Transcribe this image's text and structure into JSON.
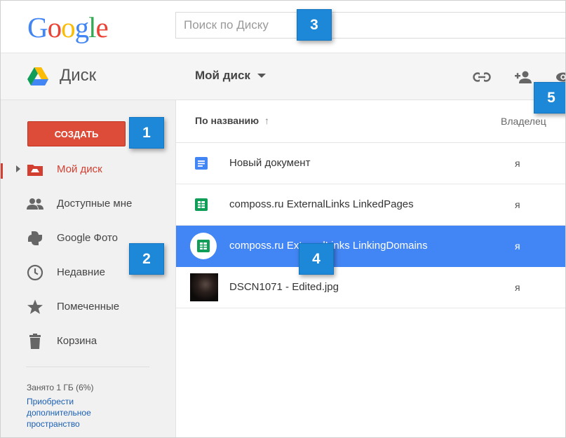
{
  "google_logo": {
    "letters": [
      {
        "ch": "G",
        "color": "#4285f4"
      },
      {
        "ch": "o",
        "color": "#ea4335"
      },
      {
        "ch": "o",
        "color": "#fbbc05"
      },
      {
        "ch": "g",
        "color": "#4285f4"
      },
      {
        "ch": "l",
        "color": "#34a853"
      },
      {
        "ch": "e",
        "color": "#ea4335"
      }
    ]
  },
  "search": {
    "placeholder": "Поиск по Диску"
  },
  "header": {
    "app_title": "Диск",
    "location_menu": "Мой диск",
    "icons": [
      "link-icon",
      "add-person-icon",
      "preview-icon"
    ]
  },
  "sidebar": {
    "create_label": "СОЗДАТЬ",
    "items": [
      {
        "label": "Мой диск",
        "icon": "my-drive-icon",
        "active": true
      },
      {
        "label": "Доступные мне",
        "icon": "shared-people-icon"
      },
      {
        "label": "Google Фото",
        "icon": "photos-pinwheel-icon"
      },
      {
        "label": "Недавние",
        "icon": "clock-icon"
      },
      {
        "label": "Помеченные",
        "icon": "star-icon"
      },
      {
        "label": "Корзина",
        "icon": "trash-icon"
      }
    ],
    "storage_text": "Занято 1 ГБ (6%)",
    "buy_link": "Приобрести дополнительное пространство"
  },
  "file_list": {
    "name_header": "По названию",
    "sort_arrow": "↑",
    "owner_header": "Владелец",
    "rows": [
      {
        "name": "Новый документ",
        "owner": "я",
        "type": "google-doc"
      },
      {
        "name": "composs.ru ExternalLinks LinkedPages",
        "owner": "я",
        "type": "google-sheet"
      },
      {
        "name": "composs.ru ExternalLinks LinkingDomains",
        "owner": "я",
        "type": "google-sheet",
        "selected": true
      },
      {
        "name": "DSCN1071 - Edited.jpg",
        "owner": "я",
        "type": "image"
      }
    ]
  },
  "callouts": [
    "1",
    "2",
    "3",
    "4",
    "5"
  ],
  "colors": {
    "create_button": "#dd4b39",
    "active_nav": "#d23f31",
    "selected_row": "#4285f4",
    "callout_badge": "#1e88d8",
    "doc_blue": "#4285f4",
    "sheet_green": "#0f9d58"
  }
}
